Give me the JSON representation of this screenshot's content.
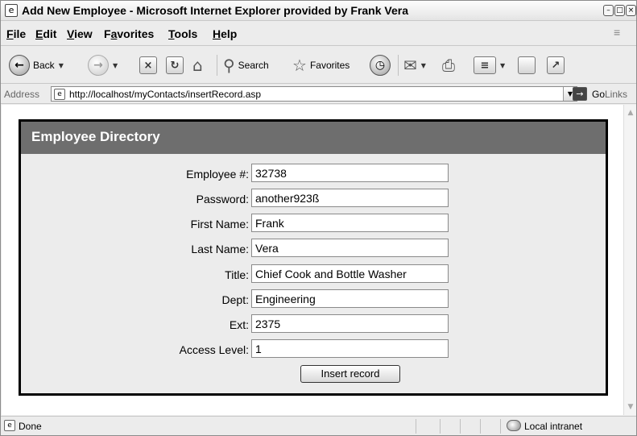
{
  "window": {
    "title": "Add New Employee - Microsoft Internet Explorer provided by Frank Vera"
  },
  "menu": [
    {
      "label": "File",
      "key": "F",
      "rest": "ile"
    },
    {
      "label": "Edit",
      "key": "E",
      "rest": "dit"
    },
    {
      "label": "View",
      "key": "V",
      "rest": "iew"
    },
    {
      "label": "Favorites",
      "key": "a",
      "pre": "F",
      "rest": "vorites"
    },
    {
      "label": "Tools",
      "key": "T",
      "rest": "ools"
    },
    {
      "label": "Help",
      "key": "H",
      "rest": "elp"
    }
  ],
  "toolbar": {
    "back_label": "Back",
    "search_label": "Search",
    "favorites_label": "Favorites"
  },
  "address": {
    "label": "Address",
    "url": "http://localhost/myContacts/insertRecord.asp",
    "go_label": "Go",
    "links_label": "Links"
  },
  "page": {
    "heading": "Employee Directory",
    "fields": [
      {
        "label": "Employee #:",
        "value": "32738"
      },
      {
        "label": "Password:",
        "value": "another923ß"
      },
      {
        "label": "First Name:",
        "value": "Frank"
      },
      {
        "label": "Last Name:",
        "value": "Vera"
      },
      {
        "label": "Title:",
        "value": "Chief Cook and Bottle Washer"
      },
      {
        "label": "Dept:",
        "value": "Engineering"
      },
      {
        "label": "Ext:",
        "value": "2375"
      },
      {
        "label": "Access Level:",
        "value": "1"
      }
    ],
    "submit_label": "Insert record"
  },
  "status": {
    "text": "Done",
    "zone": "Local intranet"
  }
}
